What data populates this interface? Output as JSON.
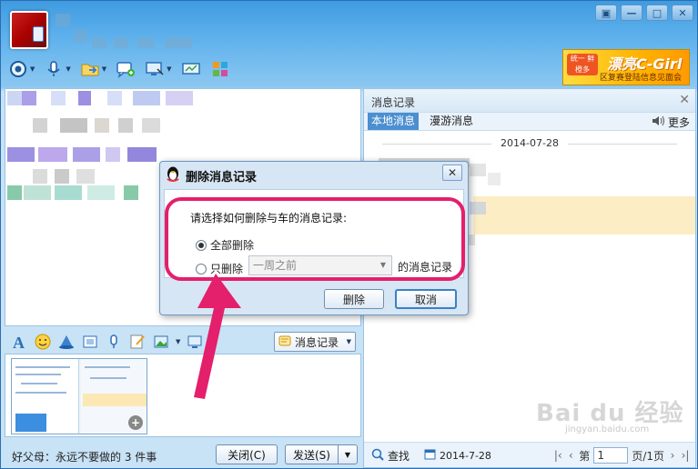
{
  "window_controls": {
    "menu": "▣",
    "minimize": "—",
    "maximize": "□",
    "close": "✕"
  },
  "banner": {
    "brand_small": "统一 鲜橙多",
    "logo_text": "漂亮C-Girl",
    "sub_text": "区复赛登陆信息见面会"
  },
  "input_toolbar": {
    "record_label": "消息记录"
  },
  "bottom": {
    "status_text": "好父母：永远不要做的 3 件事",
    "close_label": "关闭(C)",
    "send_label": "发送(S)"
  },
  "history": {
    "title": "消息记录",
    "tabs": [
      "本地消息",
      "漫游消息"
    ],
    "more_label": "更多",
    "date_header": "2014-07-28",
    "find_label": "查找",
    "date_value": "2014-7-28",
    "pager": {
      "prefix": "第",
      "page": "1",
      "suffix": "页/1页"
    }
  },
  "dialog": {
    "title": "删除消息记录",
    "prompt": "请选择如何删除与车的消息记录:",
    "option_all": "全部删除",
    "option_partial": "只删除",
    "select_value": "一周之前",
    "suffix": "的消息记录",
    "delete_label": "删除",
    "cancel_label": "取消"
  },
  "watermark": {
    "text": "Bai du 经验",
    "sub": "jingyan.baidu.com"
  },
  "colors": {
    "annotation": "#e41f6b",
    "tab_active": "#4b8fd0",
    "highlight_row": "#fcedc5"
  }
}
